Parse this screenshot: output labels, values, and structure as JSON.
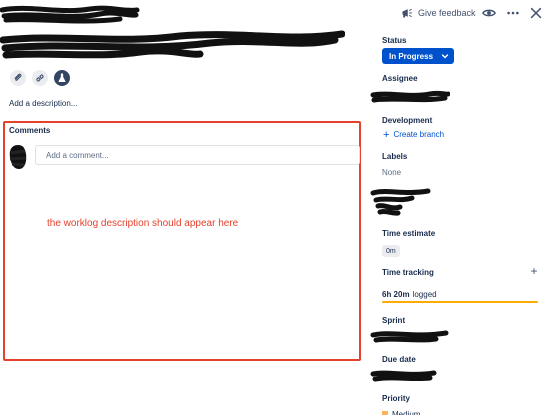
{
  "header": {
    "feedback_label": "Give feedback"
  },
  "description": {
    "add_label": "Add a description..."
  },
  "comments": {
    "title": "Comments",
    "placeholder": "Add a comment...",
    "annotation": "the worklog description should appear here",
    "highlight_color": "#e5412d"
  },
  "sidebar": {
    "status_label": "Status",
    "status_value": "In Progress",
    "status_color": "#0052cc",
    "assignee_label": "Assignee",
    "development_label": "Development",
    "create_branch_label": "Create branch",
    "labels_label": "Labels",
    "labels_value": "None",
    "time_estimate_label": "Time estimate",
    "time_estimate_value": "0m",
    "time_tracking_label": "Time tracking",
    "time_logged": "6h 20m",
    "time_logged_suffix": "logged",
    "time_tracking_progress": 1.0,
    "time_tracking_color": "#ffab00",
    "sprint_label": "Sprint",
    "due_date_label": "Due date",
    "priority_label": "Priority",
    "priority_value": "Medium"
  },
  "icons": {
    "feedback": "megaphone-icon",
    "watch": "eye-icon",
    "more": "more-icon",
    "close": "close-icon",
    "attach": "paperclip-icon",
    "link": "link-icon",
    "app": "flask-icon",
    "dropdown": "chevron-down-icon"
  }
}
